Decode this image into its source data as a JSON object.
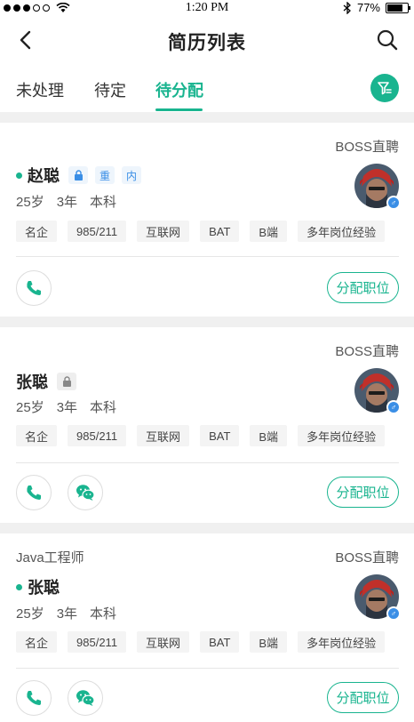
{
  "status_bar": {
    "time": "1:20 PM",
    "battery": "77%",
    "battery_level": 0.77
  },
  "nav": {
    "title": "简历列表"
  },
  "tabs": [
    {
      "label": "未处理"
    },
    {
      "label": "待定"
    },
    {
      "label": "待分配"
    }
  ],
  "active_tab": 2,
  "cards": [
    {
      "job": "",
      "source": "BOSS直聘",
      "name": "赵聪",
      "badges": [
        "重",
        "内"
      ],
      "meta": [
        "25岁",
        "3年",
        "本科"
      ],
      "tags": [
        "名企",
        "985/211",
        "互联网",
        "BAT",
        "B端",
        "多年岗位经验"
      ],
      "assign_label": "分配职位"
    },
    {
      "job": "",
      "source": "BOSS直聘",
      "name": "张聪",
      "badges": [],
      "meta": [
        "25岁",
        "3年",
        "本科"
      ],
      "tags": [
        "名企",
        "985/211",
        "互联网",
        "BAT",
        "B端",
        "多年岗位经验"
      ],
      "assign_label": "分配职位"
    },
    {
      "job": "Java工程师",
      "source": "BOSS直聘",
      "name": "张聪",
      "badges": [],
      "meta": [
        "25岁",
        "3年",
        "本科"
      ],
      "tags": [
        "名企",
        "985/211",
        "互联网",
        "BAT",
        "B端",
        "多年岗位经验"
      ],
      "assign_label": "分配职位"
    }
  ],
  "colors": {
    "accent": "#19b48f",
    "badge_blue": "#3a8ee6",
    "gender": "#3a8ee6"
  },
  "icons": [
    "back-arrow-icon",
    "search-icon",
    "filter-icon",
    "lock-icon",
    "phone-icon",
    "wechat-icon",
    "male-icon"
  ]
}
